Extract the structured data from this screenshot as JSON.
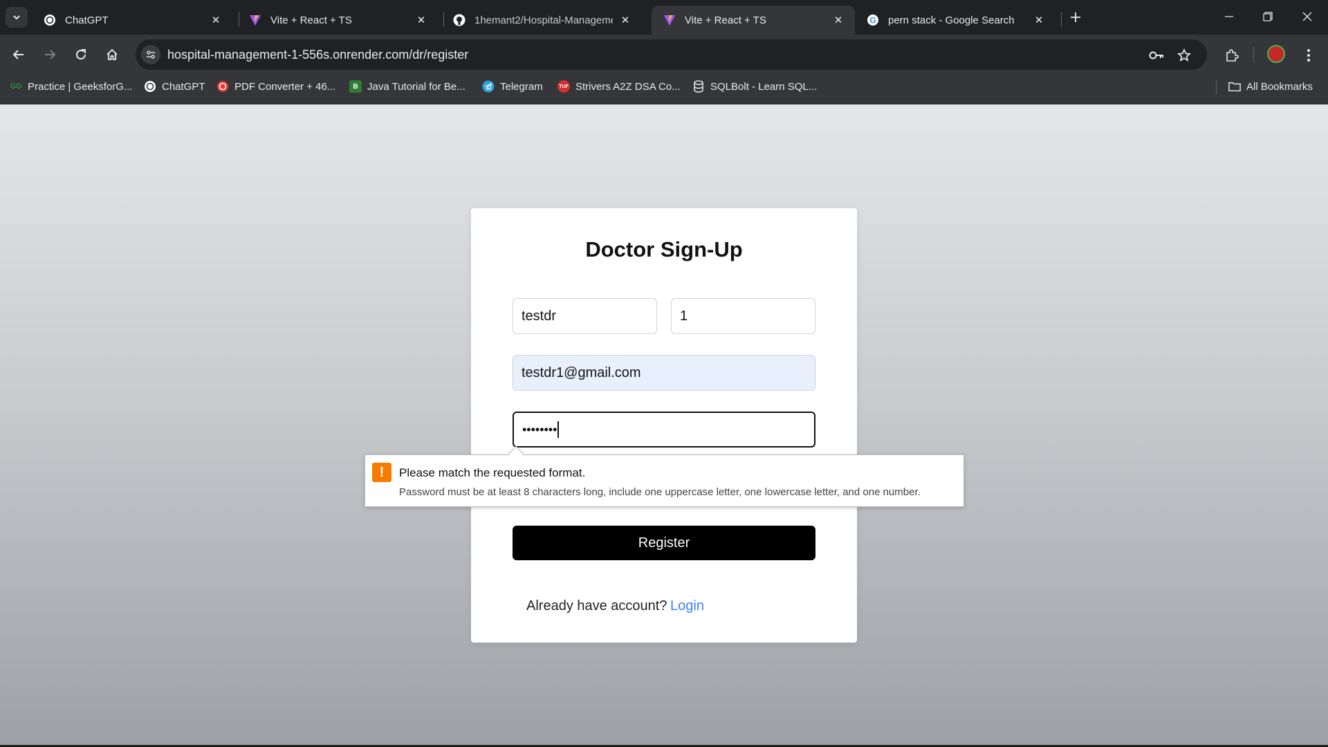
{
  "tabs": [
    {
      "title": "ChatGPT",
      "icon": "chatgpt-icon",
      "active": false
    },
    {
      "title": "Vite + React + TS",
      "icon": "vite-icon",
      "active": false
    },
    {
      "title": "1hemant2/Hospital-Manageme",
      "icon": "github-icon",
      "active": false
    },
    {
      "title": "Vite + React + TS",
      "icon": "vite-icon",
      "active": true
    },
    {
      "title": "pern stack - Google Search",
      "icon": "google-icon",
      "active": false
    }
  ],
  "address_bar": {
    "url": "hospital-management-1-556s.onrender.com/dr/register"
  },
  "bookmarks": [
    {
      "label": "Practice | GeeksforG...",
      "icon": "geeksforgeeks-icon"
    },
    {
      "label": "ChatGPT",
      "icon": "chatgpt-icon"
    },
    {
      "label": "PDF Converter + 46...",
      "icon": "pdf-converter-icon"
    },
    {
      "label": "Java Tutorial for Be...",
      "icon": "java-tutorial-icon"
    },
    {
      "label": "Telegram",
      "icon": "telegram-icon"
    },
    {
      "label": "Strivers A2Z DSA Co...",
      "icon": "tuf-icon"
    },
    {
      "label": "SQLBolt - Learn SQL...",
      "icon": "database-icon"
    }
  ],
  "all_bookmarks_label": "All Bookmarks",
  "form": {
    "title": "Doctor Sign-Up",
    "first_name_value": "testdr",
    "last_name_value": "1",
    "email_value": "testdr1@gmail.com",
    "password_masked": "••••••••",
    "register_label": "Register",
    "already_text": "Already have account?",
    "login_link": "Login"
  },
  "validation": {
    "title": "Please match the requested format.",
    "detail": "Password must be at least 8 characters long, include one uppercase letter, one lowercase letter, and one number."
  },
  "colors": {
    "login_link": "#3b82f6",
    "warning": "#f57c00",
    "button": "#000000"
  }
}
